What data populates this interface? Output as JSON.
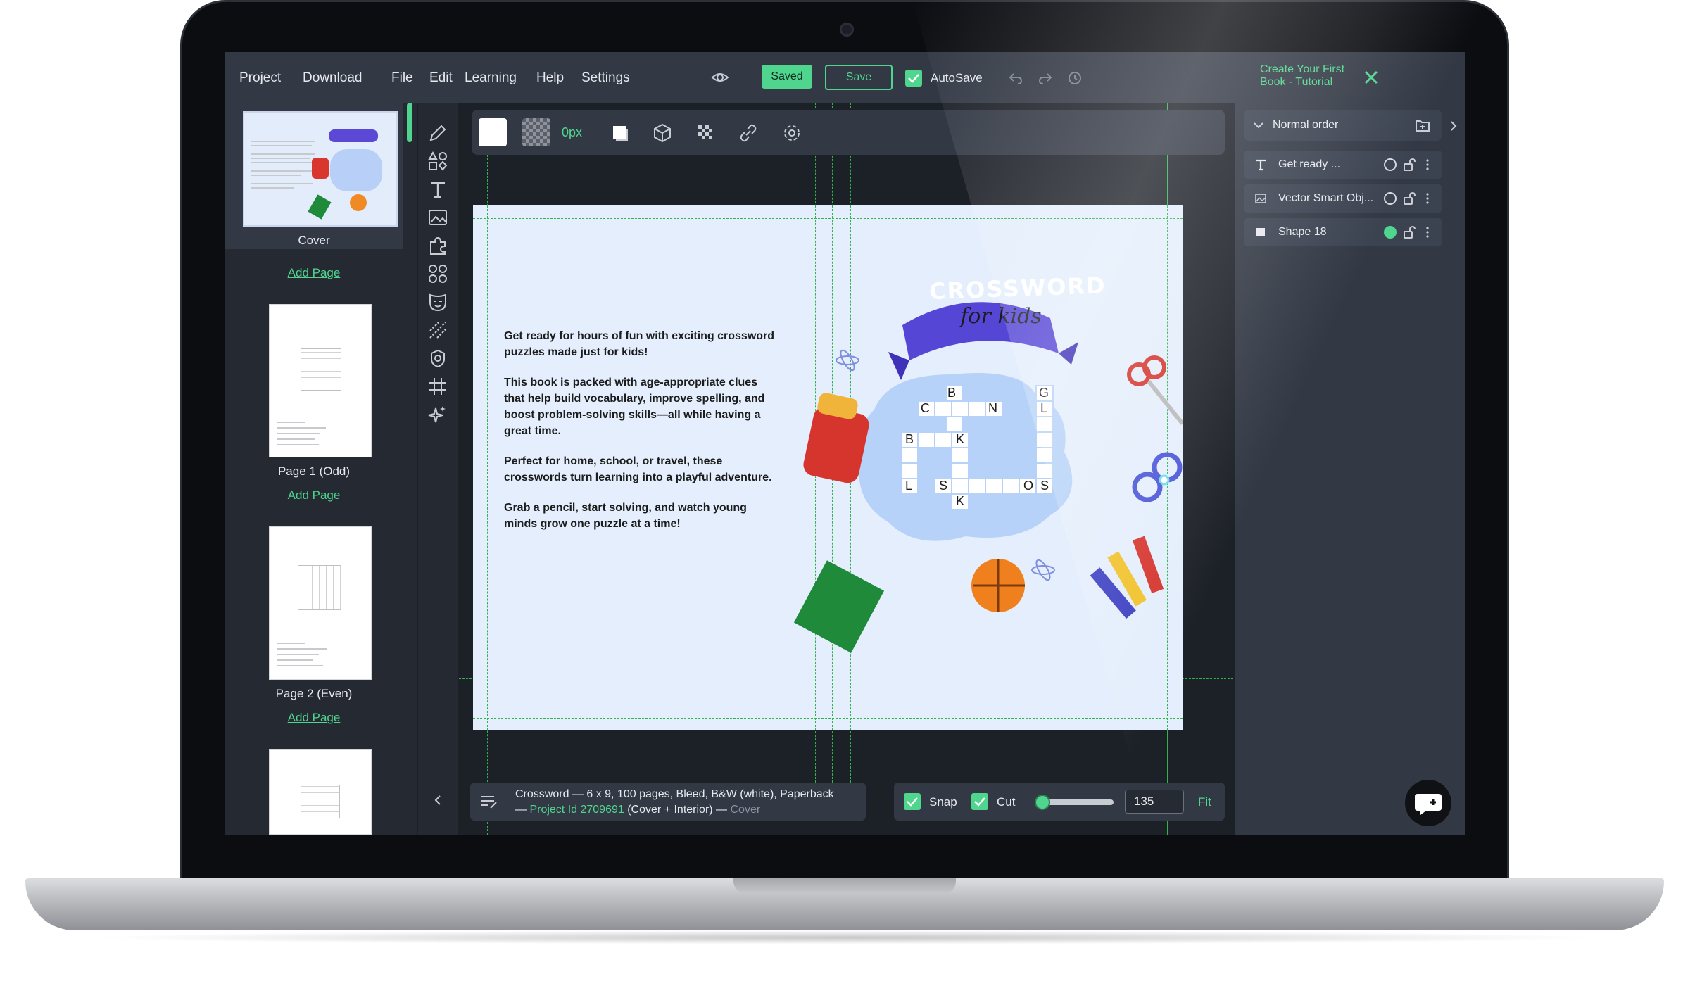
{
  "menu": {
    "items": [
      "Project",
      "Download",
      "File",
      "Edit",
      "Learning",
      "Help",
      "Settings"
    ]
  },
  "toolbar": {
    "saved_label": "Saved",
    "save_label": "Save",
    "autosave_label": "AutoSave",
    "tutorial_line1": "Create Your First",
    "tutorial_line2": "Book - Tutorial"
  },
  "pages": {
    "cover_label": "Cover",
    "add_page_label": "Add Page",
    "page1_label": "Page 1 (Odd)",
    "page2_label": "Page 2 (Even)"
  },
  "canvas_toolbar": {
    "border_width": "0px"
  },
  "canvas": {
    "paragraph1": "Get ready for hours of fun with exciting crossword puzzles made just for kids!",
    "paragraph2": "This book is packed with age-appropriate clues that help build vocabulary, improve spelling, and boost problem-solving skills—all while having a great time.",
    "paragraph3": "Perfect for home, school, or travel, these crosswords turn learning into a playful adventure.",
    "paragraph4": "Grab a pencil, start solving, and watch young minds grow one puzzle at a time!",
    "banner_title": "CROSSWORD",
    "banner_subtitle": "for kids",
    "grid_letters": [
      "B",
      "G",
      "C",
      "N",
      "L",
      "B",
      "K",
      "L",
      "S",
      "O",
      "S",
      "K"
    ]
  },
  "bottom_info": {
    "line1": "Crossword — 6 x 9, 100 pages, Bleed, B&W (white), Paperback",
    "prefix": "— ",
    "project_id": "Project Id 2709691",
    "middle": " (Cover + Interior) — ",
    "suffix": "Cover"
  },
  "bottom_tools": {
    "snap_label": "Snap",
    "cut_label": "Cut",
    "zoom_value": "135",
    "zoom_fraction": 0.08,
    "fit_label": "Fit"
  },
  "layers": {
    "order_label": "Normal order",
    "items": [
      {
        "name": "Get ready ...",
        "type": "text-icon",
        "visible_color": ""
      },
      {
        "name": "Vector Smart Obj...",
        "type": "image-icon",
        "visible_color": ""
      },
      {
        "name": "Shape 18",
        "type": "shape-icon",
        "visible_color": "#4fd58d"
      }
    ]
  },
  "colors": {
    "accent": "#4fd58d",
    "panel": "#323844",
    "canvas_bg": "#e4eefc",
    "guide": "#2fb34a"
  }
}
